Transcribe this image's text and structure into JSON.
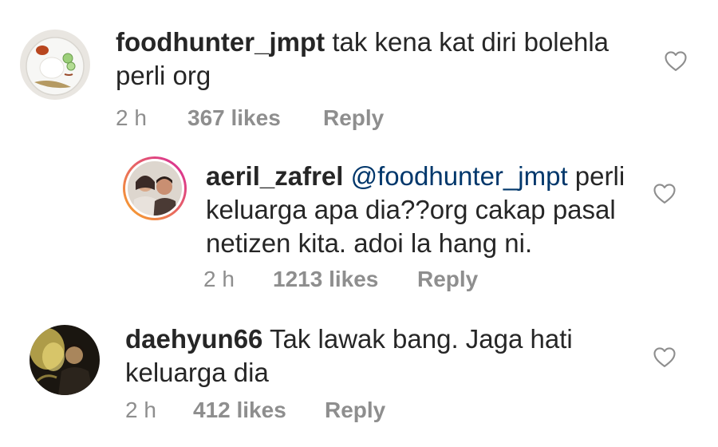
{
  "comments": [
    {
      "username": "foodhunter_jmpt",
      "text": "tak kena kat diri bolehla perli org",
      "time": "2 h",
      "likes": "367 likes",
      "reply": "Reply",
      "avatar_icon": "food-plate-avatar"
    },
    {
      "username": "aeril_zafrel",
      "mention": "@foodhunter_jmpt",
      "text": "perli keluarga apa dia??org cakap pasal netizen kita. adoi la hang ni.",
      "time": "2 h",
      "likes": "1213 likes",
      "reply": "Reply",
      "avatar_icon": "couple-photo-avatar-story-ring"
    },
    {
      "username": "daehyun66",
      "text": "Tak lawak bang. Jaga hati keluarga dia",
      "time": "2 h",
      "likes": "412 likes",
      "reply": "Reply",
      "avatar_icon": "performer-photo-avatar"
    }
  ],
  "icons": {
    "like": "heart-outline-icon"
  },
  "colors": {
    "text": "#262626",
    "meta": "#8e8e8e",
    "mention": "#00376b",
    "story_ring_start": "#f9a825",
    "story_ring_end": "#d6249f"
  }
}
